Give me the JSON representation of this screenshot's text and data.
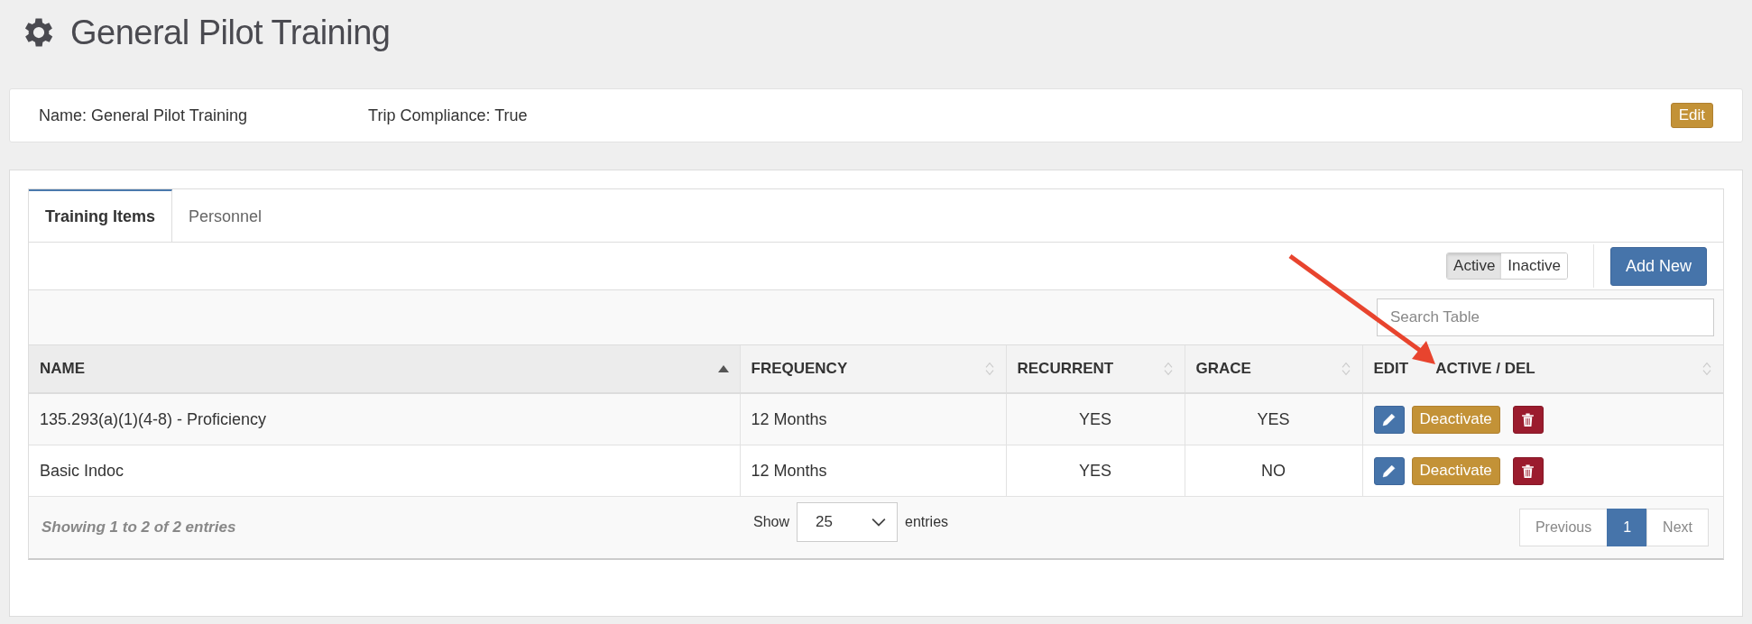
{
  "page": {
    "title": "General Pilot Training"
  },
  "info": {
    "name": "Name: General Pilot Training",
    "compliance": "Trip Compliance: True",
    "edit_button": "Edit"
  },
  "tabs": [
    {
      "label": "Training Items",
      "selected": true
    },
    {
      "label": "Personnel",
      "selected": false
    }
  ],
  "filter": [
    {
      "label": "Active",
      "selected": true
    },
    {
      "label": "Inactive",
      "selected": false
    }
  ],
  "add_button": "Add New",
  "search": {
    "placeholder": "Search Table"
  },
  "table": {
    "columns": [
      {
        "label": "NAME",
        "sorted": true
      },
      {
        "label": "FREQUENCY",
        "sorted": false
      },
      {
        "label": "RECURRENT",
        "sorted": false
      },
      {
        "label": "GRACE",
        "sorted": false
      },
      {
        "label": "EDIT",
        "label_2": "ACTIVE / DEL",
        "sorted": false
      }
    ],
    "rows": [
      {
        "name": "135.293(a)(1)(4-8) - Proficiency",
        "frequency": "12 Months",
        "recurrent": "YES",
        "grace": "YES",
        "action": "Deactivate"
      },
      {
        "name": "Basic Indoc",
        "frequency": "12 Months",
        "recurrent": "YES",
        "grace": "NO",
        "action": "Deactivate"
      }
    ]
  },
  "footer": {
    "summary": "Showing 1 to 2 of 2 entries",
    "show_label": "Show",
    "page_size": "25",
    "entries_label": "entries",
    "previous": "Previous",
    "pages": [
      {
        "label": "1",
        "selected": true
      }
    ],
    "next": "Next"
  }
}
